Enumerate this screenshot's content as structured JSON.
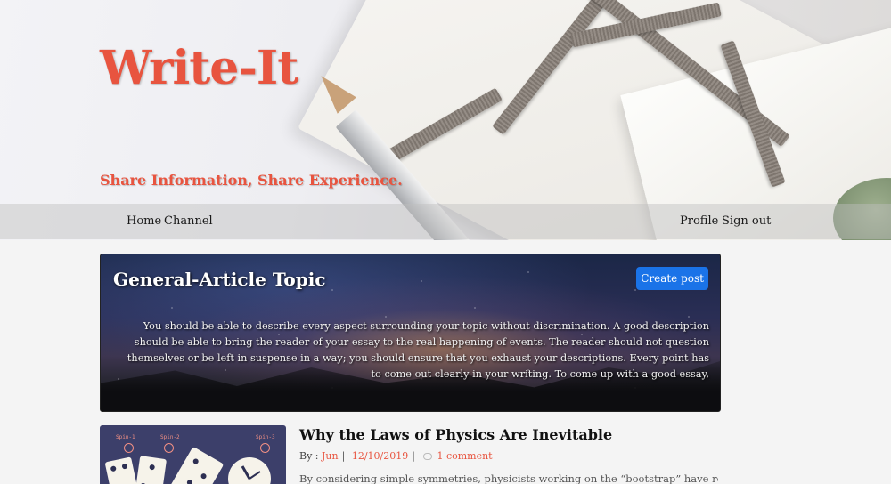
{
  "site": {
    "title": "Write-It",
    "tagline": "Share Information, Share Experience.",
    "accent_color": "#e8543f"
  },
  "nav": {
    "left": [
      "Home",
      "Channel"
    ],
    "right": [
      "Profile",
      "Sign out"
    ]
  },
  "topic": {
    "title": "General-Article Topic",
    "create_button": "Create post",
    "button_color": "#1a73e8",
    "description": "You should be able to describe every aspect surrounding your topic without discrimination. A good description should be able to bring the reader of your essay to the real happening of events. The reader should not question themselves or be left in suspense in a way; you should ensure that you exhaust your descriptions. Every point has to come out clearly in your writing. To come up with a good essay,"
  },
  "article": {
    "title": "Why the Laws of Physics Are Inevitable",
    "by_label": "By :",
    "author": "Jun",
    "date": "12/10/2019",
    "comments": "1 comment",
    "excerpt": "By considering simple symmetries, physicists working on the “bootstrap” have rederived the",
    "thumbnail": {
      "labels": [
        "Spin-1",
        "Spin-2",
        "Spin-3"
      ],
      "icons": [
        "domino-icon",
        "playing-card-icon",
        "clock-dial-icon"
      ]
    }
  }
}
